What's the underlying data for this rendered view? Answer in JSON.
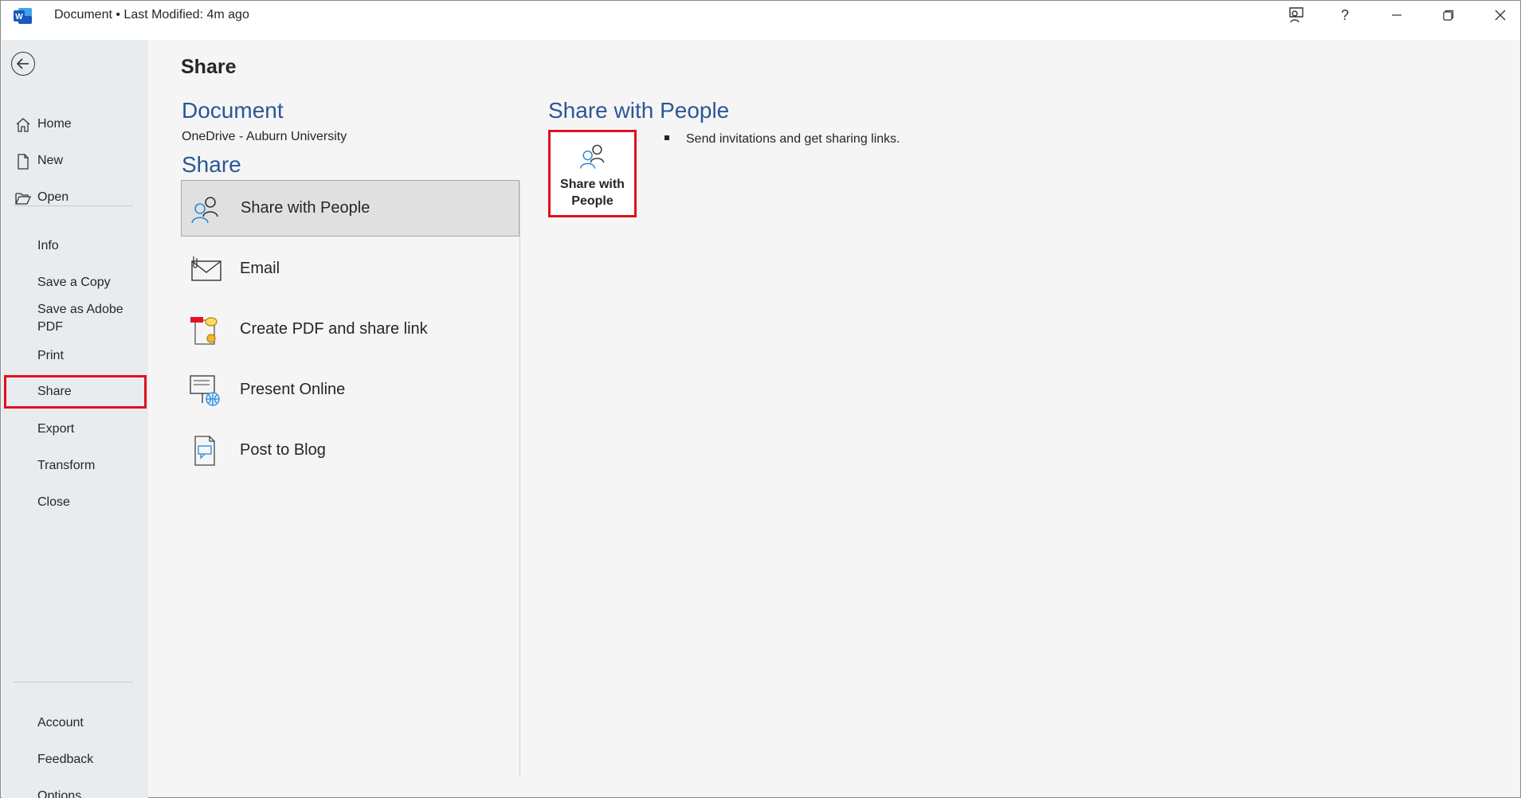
{
  "titlebar": {
    "title": "Document  •  Last Modified: 4m ago",
    "buttons": [
      "presenter-coach",
      "help",
      "minimize",
      "restore",
      "close"
    ],
    "help_label": "?"
  },
  "nav": {
    "top_items": [
      {
        "label": "Home",
        "icon": "home-icon"
      },
      {
        "label": "New",
        "icon": "new-document-icon"
      },
      {
        "label": "Open",
        "icon": "folder-open-icon"
      }
    ],
    "middle_items": [
      "Info",
      "Save a Copy",
      "Save as Adobe PDF",
      "Print",
      "Share",
      "Export",
      "Transform",
      "Close"
    ],
    "bottom_items": [
      "Account",
      "Feedback",
      "Options"
    ],
    "selected": "Share"
  },
  "main": {
    "page_title": "Share",
    "doc_heading": "Document",
    "doc_location": "OneDrive - Auburn University",
    "share_heading": "Share",
    "options": [
      {
        "label": "Share with People",
        "icon": "people-icon",
        "active": true
      },
      {
        "label": "Email",
        "icon": "envelope-icon",
        "active": false
      },
      {
        "label": "Create PDF and share link",
        "icon": "pdf-share-icon",
        "active": false
      },
      {
        "label": "Present Online",
        "icon": "present-online-icon",
        "active": false
      },
      {
        "label": "Post to Blog",
        "icon": "blog-post-icon",
        "active": false
      }
    ]
  },
  "detail": {
    "heading": "Share with People",
    "button_label_line1": "Share with",
    "button_label_line2": "People",
    "description": "Send invitations and get sharing links."
  },
  "colors": {
    "accent_blue": "#2b5797",
    "highlight_red": "#e0111b",
    "word_blue": "#185abd"
  }
}
